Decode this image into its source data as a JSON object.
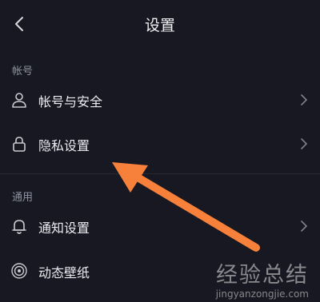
{
  "header": {
    "title": "设置"
  },
  "sections": [
    {
      "heading": "帐号"
    },
    {
      "heading": "通用"
    }
  ],
  "rows": [
    {
      "label": "帐号与安全",
      "icon": "user-icon"
    },
    {
      "label": "隐私设置",
      "icon": "lock-icon"
    },
    {
      "label": "通知设置",
      "icon": "bell-icon"
    },
    {
      "label": "动态壁纸",
      "icon": "wallpaper-icon"
    }
  ],
  "annotation": {
    "arrow_color": "#f7813a"
  },
  "watermark": {
    "line1": "经验总结",
    "line2": "jingyanzongjie.com"
  }
}
